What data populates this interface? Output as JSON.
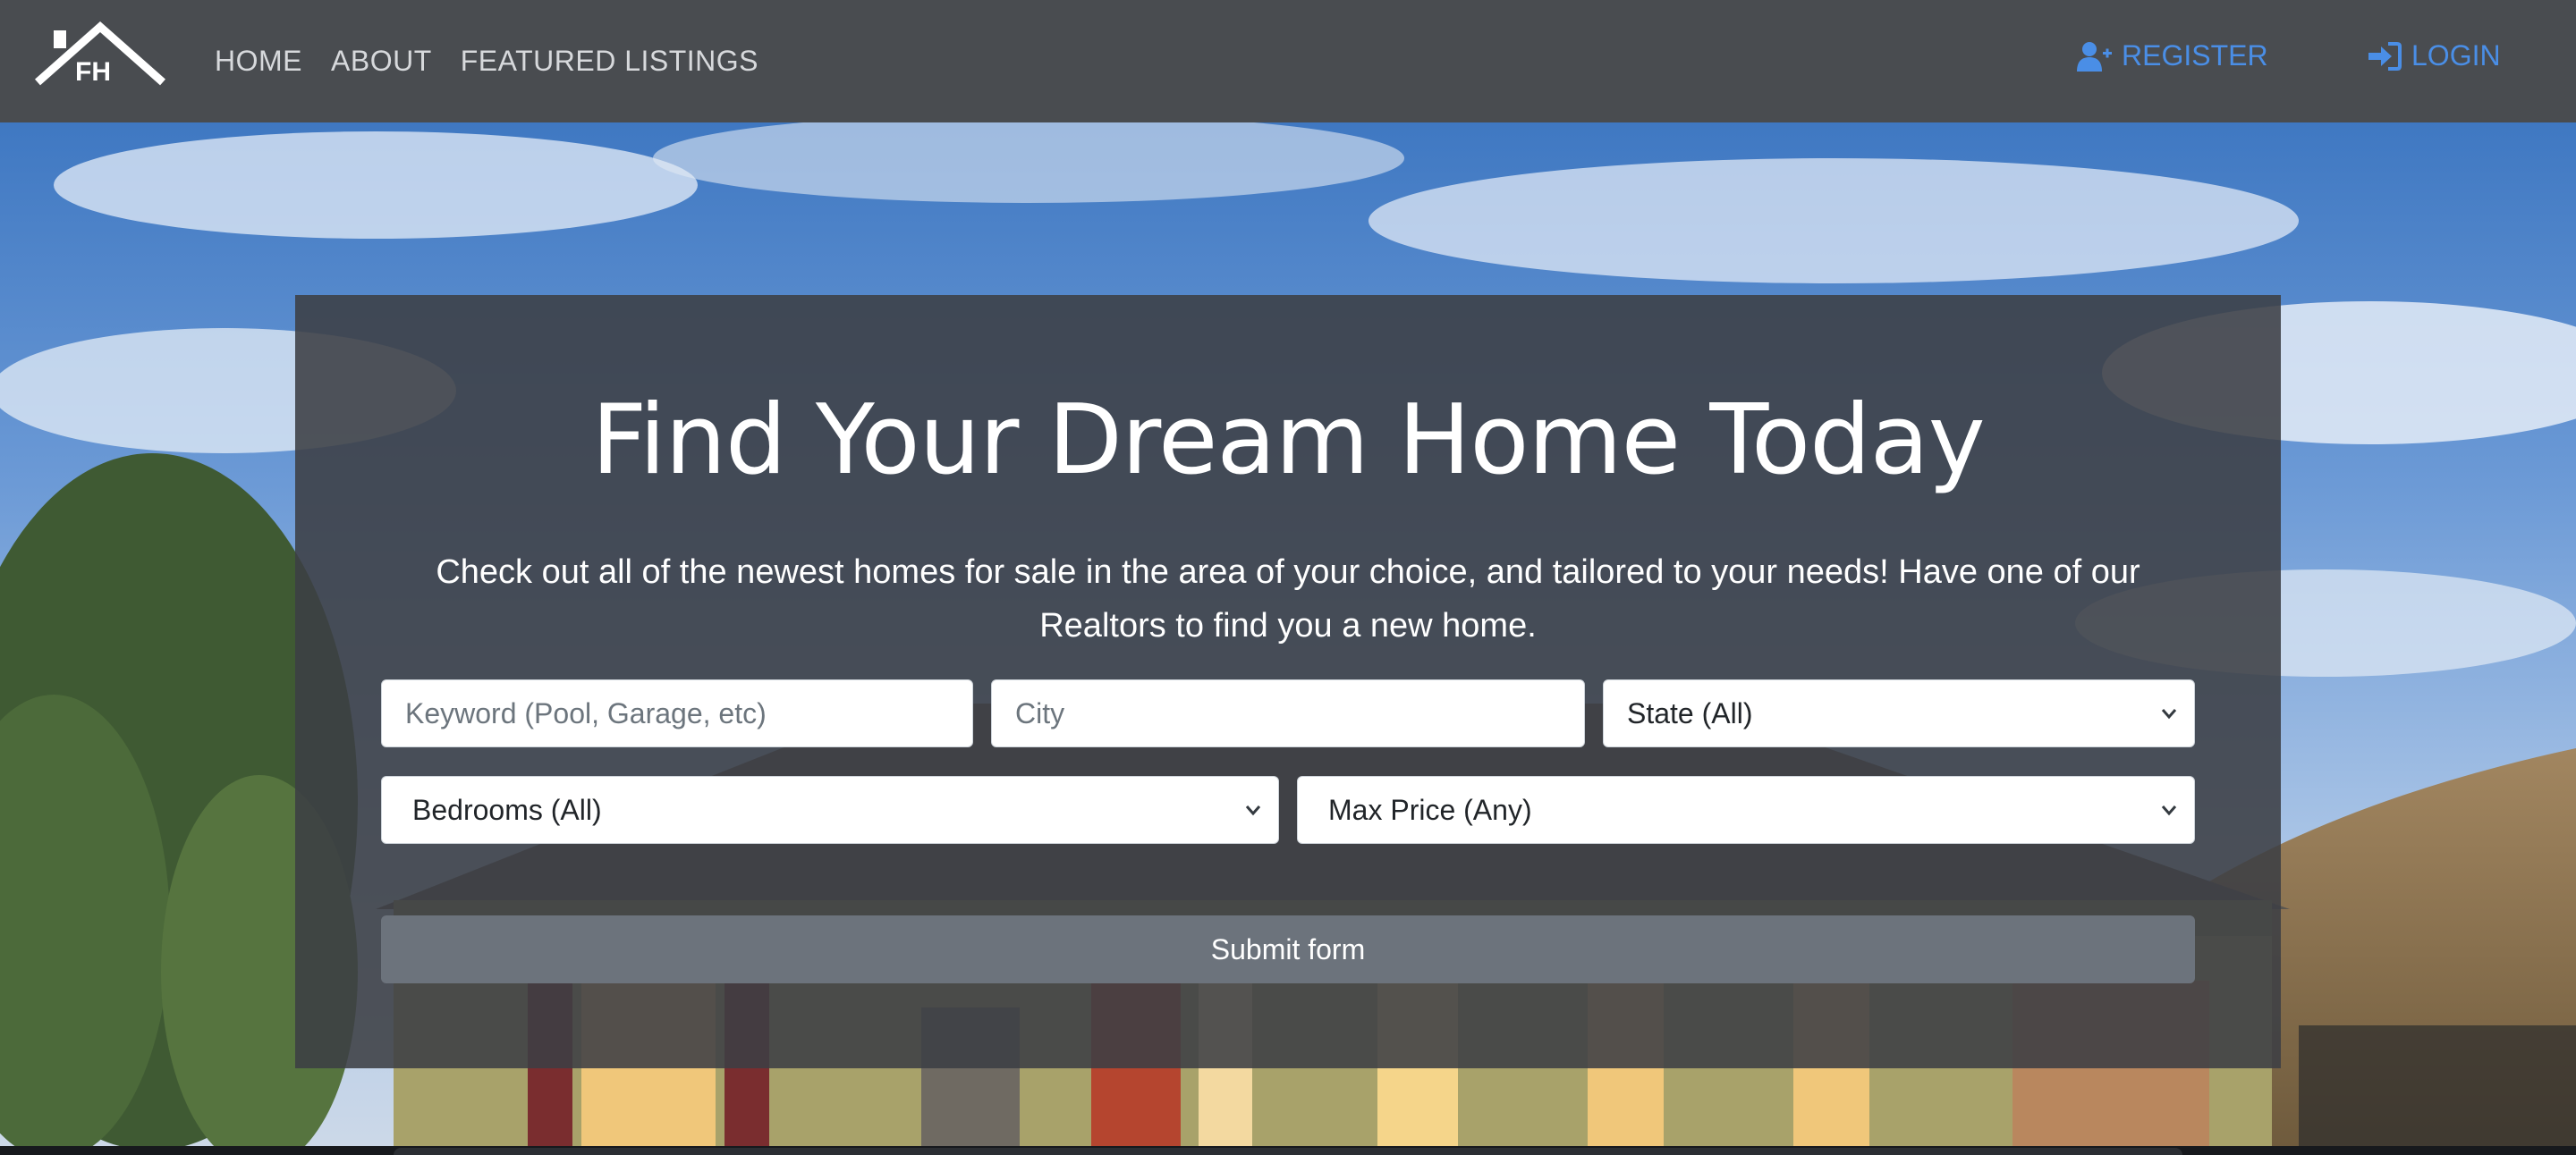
{
  "brand": {
    "logo_text": "FH"
  },
  "nav": {
    "items": [
      {
        "label": "HOME"
      },
      {
        "label": "ABOUT"
      },
      {
        "label": "FEATURED LISTINGS"
      }
    ],
    "register_label": "REGISTER",
    "login_label": "LOGIN"
  },
  "hero": {
    "title": "Find Your Dream Home Today",
    "subtitle": "Check out all of the newest homes for sale in the area of your choice, and tailored to your needs! Have one of our Realtors to find you a new home."
  },
  "search_form": {
    "keyword_placeholder": "Keyword (Pool, Garage, etc)",
    "city_placeholder": "City",
    "state_selected": "State (All)",
    "bedrooms_selected": "Bedrooms (All)",
    "max_price_selected": "Max Price (Any)",
    "submit_label": "Submit form"
  },
  "colors": {
    "navbar_bg": "#494c50",
    "accent_link": "#4a8ee6",
    "panel_bg": "#3c3f44",
    "submit_bg": "#6c737c"
  },
  "icons": {
    "register": "user-plus-icon",
    "login": "sign-in-icon",
    "select_caret": "chevron-down-icon"
  }
}
